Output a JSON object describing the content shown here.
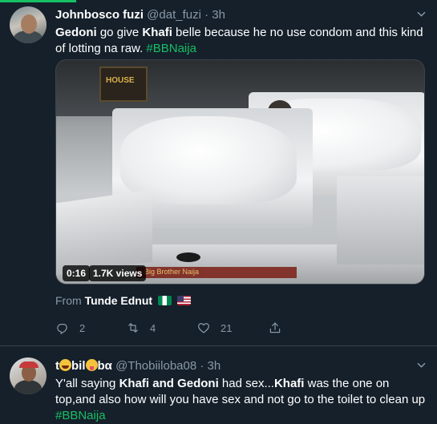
{
  "tweet1": {
    "display_name": "Johnbosco fuzi",
    "handle": "@dat_fuzi",
    "separator": "·",
    "time": "3h",
    "text": {
      "part1": "Gedoni",
      "part2": "  go give ",
      "part3": "Khafi",
      "part4": " belle because he no use condom and this kind of lotting na raw. ",
      "hashtag": "#BBNaija"
    },
    "media": {
      "duration": "0:16",
      "views": "1.7K views",
      "sign_text": "HOUSE",
      "ticker_text": "Big Brother Naija"
    },
    "source": {
      "prefix": "From ",
      "name": "Tunde Ednut"
    },
    "actions": {
      "reply_count": "2",
      "retweet_count": "4",
      "like_count": "21"
    },
    "icons": [
      "chevron-down-icon",
      "reply-icon",
      "retweet-icon",
      "like-icon",
      "share-icon",
      "nigeria-flag-icon",
      "us-flag-icon"
    ]
  },
  "tweet2": {
    "display_name_prefix": "t",
    "display_name_mid": "bil",
    "display_name_suffix": "bα",
    "handle": "@Thobiiloba08",
    "separator": "·",
    "time": "3h",
    "text": {
      "p1": "Y'all saying ",
      "p2": "Khafi and Gedoni",
      "p3": " had sex...",
      "p4": "Khafi",
      "p5": " was the one on top,and also how will you have sex and not go to the toilet to clean up ",
      "hashtag": "#BBNaija"
    }
  },
  "colors": {
    "background": "#15202b",
    "muted": "#8899a6",
    "hashtag": "#17bf63",
    "divider": "#38444d"
  }
}
